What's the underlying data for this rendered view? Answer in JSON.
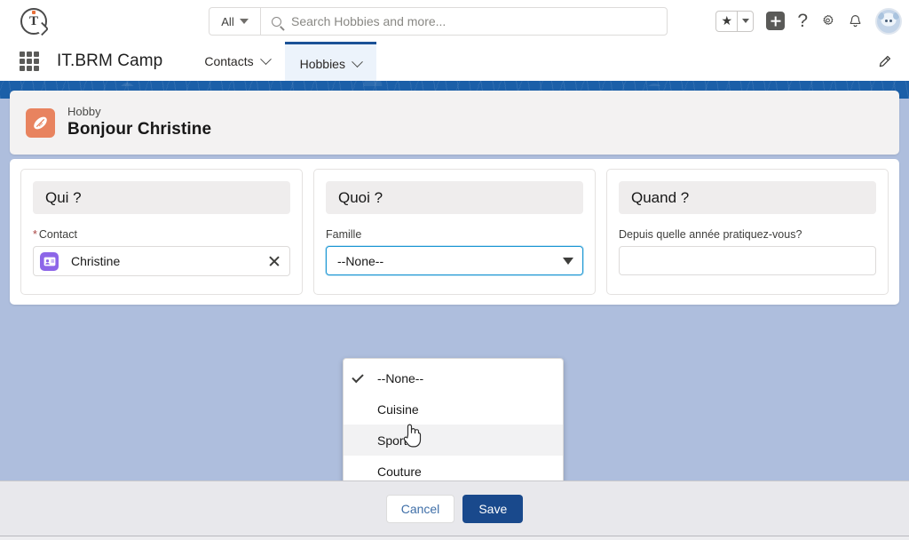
{
  "header": {
    "logo_name": "tbrm-logo",
    "search": {
      "scope_label": "All",
      "placeholder": "Search Hobbies and more...",
      "value": ""
    },
    "icons": [
      {
        "name": "favorites-star-icon",
        "glyph": "★"
      },
      {
        "name": "favorites-dropdown-icon"
      },
      {
        "name": "new-item-plus-icon"
      },
      {
        "name": "help-question-icon",
        "glyph": "?"
      },
      {
        "name": "setup-gear-icon"
      },
      {
        "name": "notifications-bell-icon"
      },
      {
        "name": "user-avatar"
      }
    ]
  },
  "app_nav": {
    "app_name": "IT.BRM Camp",
    "tabs": [
      {
        "label": "Contacts",
        "active": false
      },
      {
        "label": "Hobbies",
        "active": true
      }
    ],
    "edit_label": "Edit"
  },
  "record": {
    "object_label": "Hobby",
    "title": "Bonjour Christine",
    "icon_name": "hobby-football-icon"
  },
  "sections": [
    {
      "heading": "Qui ?",
      "field": {
        "label": "Contact",
        "required_marker": "*",
        "type": "lookup-pill",
        "value": "Christine",
        "icon_name": "contact-card-icon"
      }
    },
    {
      "heading": "Quoi ?",
      "field": {
        "label": "Famille",
        "required_marker": "",
        "type": "picklist",
        "value": "--None--"
      }
    },
    {
      "heading": "Quand ?",
      "field": {
        "label": "Depuis quelle année pratiquez-vous?",
        "required_marker": "",
        "type": "text",
        "value": "",
        "placeholder": ""
      }
    }
  ],
  "dropdown": {
    "open": true,
    "options": [
      {
        "label": "--None--",
        "selected": true,
        "hovered": false
      },
      {
        "label": "Cuisine",
        "selected": false,
        "hovered": false
      },
      {
        "label": "Sport",
        "selected": false,
        "hovered": true
      },
      {
        "label": "Couture",
        "selected": false,
        "hovered": false
      }
    ]
  },
  "footer": {
    "cancel_label": "Cancel",
    "save_label": "Save"
  },
  "colors": {
    "brand_blue": "#1b5fa8",
    "save_button": "#19498c",
    "banner_blue": "#1b5fa8",
    "modal_backdrop": "#aebedd",
    "record_icon": "#e8835f",
    "contact_icon": "#8d66e8",
    "focus_border": "#1b96d3",
    "active_tab_bar": "#1b5297"
  }
}
